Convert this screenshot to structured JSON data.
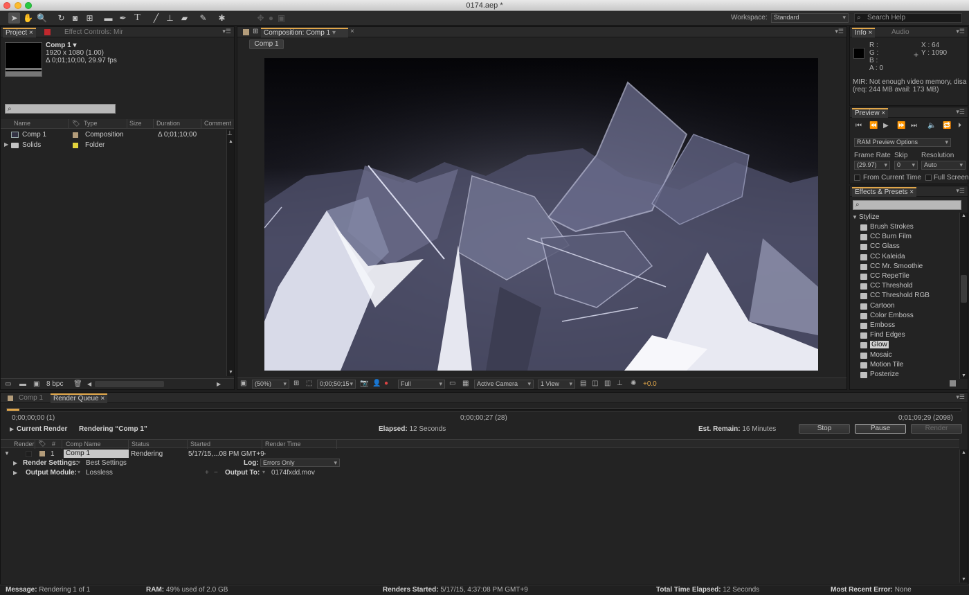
{
  "window": {
    "title": "0174.aep *"
  },
  "workspace": {
    "label": "Workspace:",
    "value": "Standard",
    "search_placeholder": "Search Help"
  },
  "toolbar": {
    "tools": [
      "selection-tool",
      "hand-tool",
      "zoom-tool",
      "rotate-tool",
      "camera-tool",
      "pan-behind-tool",
      "rectangle-tool",
      "pen-tool",
      "type-tool",
      "brush-tool",
      "clone-stamp-tool",
      "eraser-tool",
      "roto-brush-tool",
      "puppet-pin-tool"
    ]
  },
  "project": {
    "tabs": [
      "Project",
      "Effect Controls: Mir"
    ],
    "comp_name": "Comp 1 ▾",
    "comp_size": "1920 x 1080 (1.00)",
    "comp_duration": "Δ 0;01;10;00, 29.97 fps",
    "columns": [
      "Name",
      "Type",
      "Size",
      "Duration",
      "Comment"
    ],
    "items": [
      {
        "name": "Comp 1",
        "type": "Composition",
        "size": "",
        "duration": "Δ 0;01;10;00",
        "label_color": "#b39c7a"
      },
      {
        "name": "Solids",
        "type": "Folder",
        "size": "",
        "duration": "",
        "label_color": "#e3d33c"
      }
    ],
    "bpc": "8 bpc"
  },
  "composition": {
    "tab": "Composition: Comp 1",
    "breadcrumb": "Comp 1",
    "zoom": "(50%)",
    "timecode": "0;00;50;15",
    "resolution": "Full",
    "camera": "Active Camera",
    "view": "1 View",
    "exposure": "+0.0"
  },
  "info": {
    "tabs": [
      "Info",
      "Audio"
    ],
    "r": "R :",
    "g": "G :",
    "b": "B :",
    "a": "A : 0",
    "x": "X : 64",
    "y": "Y : 1090",
    "message1": "MIR: Not enough video memory, disa",
    "message2": "(req: 244 MB avail: 173 MB)"
  },
  "preview": {
    "tab": "Preview",
    "options": "RAM Preview Options",
    "frame_rate_label": "Frame Rate",
    "skip_label": "Skip",
    "resolution_label": "Resolution",
    "frame_rate": "(29.97)",
    "skip": "0",
    "resolution": "Auto",
    "from_current": "From Current Time",
    "full_screen": "Full Screen"
  },
  "effects": {
    "tab": "Effects & Presets",
    "category": "Stylize",
    "items": [
      "Brush Strokes",
      "CC Burn Film",
      "CC Glass",
      "CC Kaleida",
      "CC Mr. Smoothie",
      "CC RepeTile",
      "CC Threshold",
      "CC Threshold RGB",
      "Cartoon",
      "Color Emboss",
      "Emboss",
      "Find Edges",
      "Glow",
      "Mosaic",
      "Motion Tile",
      "Posterize"
    ],
    "selected": "Glow"
  },
  "render_queue": {
    "tabs": [
      "Comp 1",
      "Render Queue"
    ],
    "start_time": "0;00;00;00 (1)",
    "current_time": "0;00;00;27 (28)",
    "end_time": "0;01;09;29 (2098)",
    "progress": 0.013,
    "current_render_label": "Current Render",
    "rendering_text": "Rendering “Comp 1”",
    "elapsed_label": "Elapsed:",
    "elapsed": "12 Seconds",
    "est_remain_label": "Est. Remain:",
    "est_remain": "16 Minutes",
    "stop": "Stop",
    "pause": "Pause",
    "render": "Render",
    "columns": [
      "Render",
      "#",
      "Comp Name",
      "Status",
      "Started",
      "Render Time"
    ],
    "item": {
      "number": "1",
      "comp": "Comp 1",
      "status": "Rendering",
      "started": "5/17/15,...08 PM GMT+9",
      "render_time": "-"
    },
    "render_settings_label": "Render Settings:",
    "render_settings": "Best Settings",
    "log_label": "Log:",
    "log": "Errors Only",
    "output_module_label": "Output Module:",
    "output_module": "Lossless",
    "output_to_label": "Output To:",
    "output_to": "0174fxdd.mov"
  },
  "status": {
    "message_label": "Message:",
    "message": "Rendering 1 of 1",
    "ram_label": "RAM:",
    "ram": "49% used of 2.0 GB",
    "renders_started_label": "Renders Started:",
    "renders_started": "5/17/15, 4:37:08 PM GMT+9",
    "total_elapsed_label": "Total Time Elapsed:",
    "total_elapsed": "12 Seconds",
    "recent_error_label": "Most Recent Error:",
    "recent_error": "None"
  },
  "colors": {
    "accent": "#e0a64a",
    "panel": "#232323"
  }
}
